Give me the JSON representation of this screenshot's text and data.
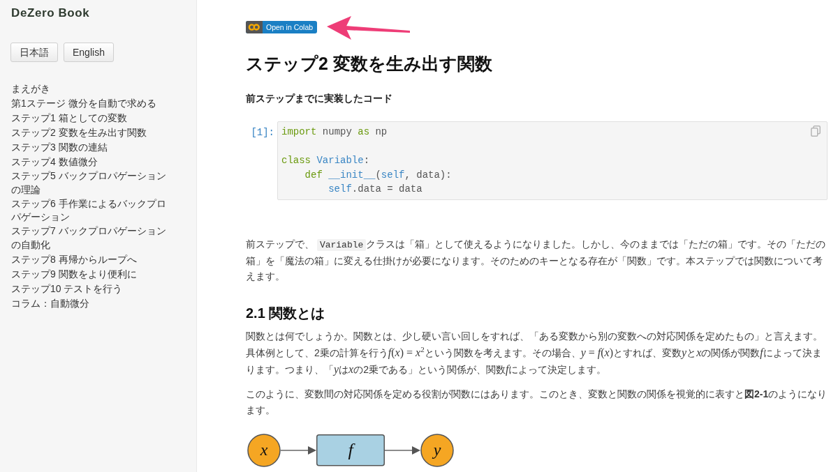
{
  "sidebar": {
    "title": "DeZero Book",
    "language_buttons": [
      "日本語",
      "English"
    ],
    "items": [
      "まえがき",
      "第1ステージ 微分を自動で求める",
      "ステップ1 箱としての変数",
      "ステップ2 変数を生み出す関数",
      "ステップ3 関数の連結",
      "ステップ4 数値微分",
      "ステップ5 バックプロパゲーションの理論",
      "ステップ6 手作業によるバックプロパゲーション",
      "ステップ7 バックプロパゲーションの自動化",
      "ステップ8 再帰からループへ",
      "ステップ9 関数をより便利に",
      "ステップ10 テストを行う",
      "コラム：自動微分"
    ]
  },
  "content": [
    {
      "kind": "badge",
      "label": "Open in Colab"
    },
    {
      "kind": "title",
      "text": "ステップ2 変数を生み出す関数"
    },
    {
      "kind": "subheading",
      "text": "前ステップまでに実装したコード"
    },
    {
      "kind": "code_cell",
      "prompt": "[1]:",
      "tokens": [
        {
          "text": "import",
          "kind": "keyword"
        },
        {
          "text": " numpy ",
          "kind": "plain"
        },
        {
          "text": "as",
          "kind": "keyword"
        },
        {
          "text": " np\n\n",
          "kind": "plain"
        },
        {
          "text": "class ",
          "kind": "keyword"
        },
        {
          "text": "Variable",
          "kind": "name"
        },
        {
          "text": ":\n    ",
          "kind": "plain"
        },
        {
          "text": "def ",
          "kind": "keyword"
        },
        {
          "text": "__init__",
          "kind": "name"
        },
        {
          "text": "(",
          "kind": "plain"
        },
        {
          "text": "self",
          "kind": "name"
        },
        {
          "text": ", data):\n        ",
          "kind": "plain"
        },
        {
          "text": "self",
          "kind": "name"
        },
        {
          "text": ".data = data",
          "kind": "plain"
        }
      ]
    },
    {
      "kind": "paragraph",
      "segments": [
        {
          "kind": "text",
          "text": "前ステップで、 "
        },
        {
          "kind": "code",
          "text": "Variable"
        },
        {
          "kind": "text",
          "text": "クラスは「箱」として使えるようになりました。しかし、今のままでは「ただの箱」です。その「ただの箱」を「魔法の箱」に変える仕掛けが必要になります。そのためのキーとなる存在が「関数」です。本ステップでは関数について考えます。"
        }
      ]
    },
    {
      "kind": "heading",
      "text": "2.1 関数とは"
    },
    {
      "kind": "paragraph",
      "segments": [
        {
          "kind": "text",
          "text": "関数とは何でしょうか。関数とは、少し硬い言い回しをすれば、「ある変数から別の変数への対応関係を定めたもの」と言えます。具体例として、2乗の計算を行う"
        },
        {
          "kind": "math",
          "text": "*f*(*x*) = *x*$^{2}$"
        },
        {
          "kind": "text",
          "text": "という関数を考えます。その場合、"
        },
        {
          "kind": "math",
          "text": "*y* = *f*(*x*)"
        },
        {
          "kind": "text",
          "text": "とすれば、変数"
        },
        {
          "kind": "math",
          "text": "*y*"
        },
        {
          "kind": "text",
          "text": "と"
        },
        {
          "kind": "math",
          "text": "*x*"
        },
        {
          "kind": "text",
          "text": "の関係が関数"
        },
        {
          "kind": "math",
          "text": "*f*"
        },
        {
          "kind": "text",
          "text": "によって決まります。つまり、「"
        },
        {
          "kind": "math",
          "text": "*y*"
        },
        {
          "kind": "text",
          "text": "は"
        },
        {
          "kind": "math",
          "text": "*x*"
        },
        {
          "kind": "text",
          "text": "の2乗である」という関係が、関数"
        },
        {
          "kind": "math",
          "text": "*f*"
        },
        {
          "kind": "text",
          "text": "によって決定します。"
        }
      ]
    },
    {
      "kind": "paragraph",
      "segments": [
        {
          "kind": "text",
          "text": "このように、変数間の対応関係を定める役割が関数にはあります。このとき、変数と関数の関係を視覚的に表すと**図2-1**のようになります。"
        }
      ]
    },
    {
      "kind": "figure",
      "nodes": [
        {
          "label": "x",
          "kind": "variable"
        },
        {
          "label": "f",
          "kind": "function"
        },
        {
          "label": "y",
          "kind": "variable"
        }
      ]
    }
  ]
}
